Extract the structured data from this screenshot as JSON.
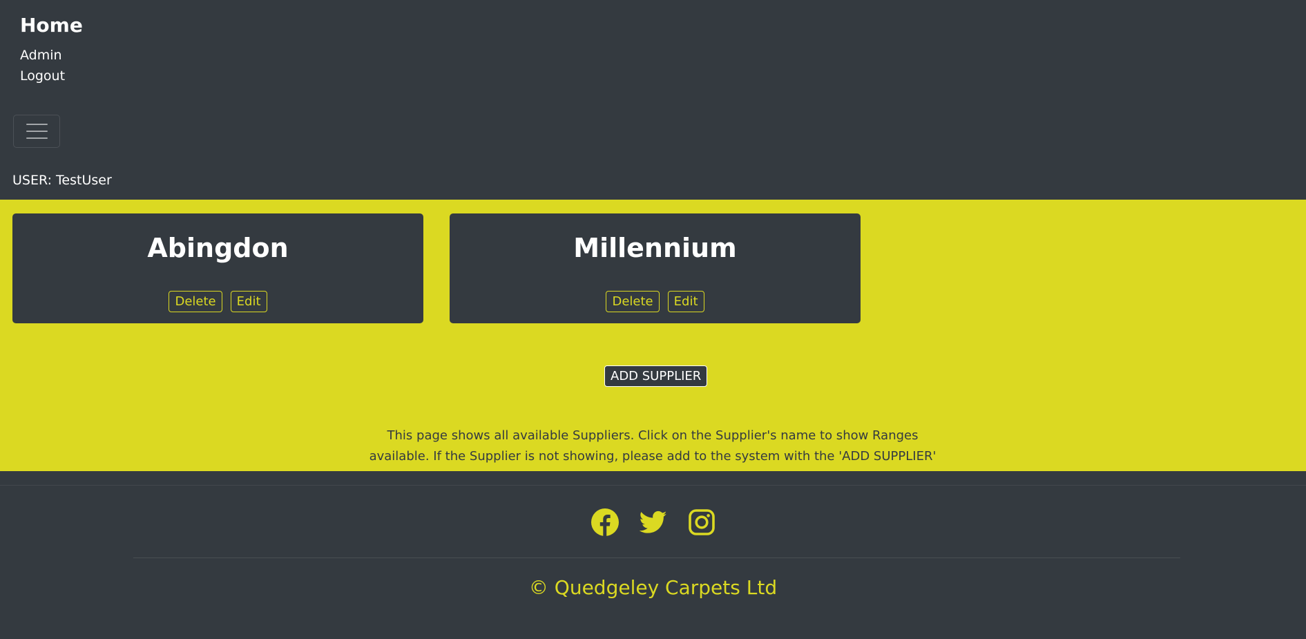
{
  "header": {
    "brand": "Home",
    "nav": [
      {
        "label": "Admin"
      },
      {
        "label": "Logout"
      }
    ],
    "user_text": "USER: TestUser"
  },
  "suppliers": [
    {
      "name": "Abingdon",
      "delete_label": "Delete",
      "edit_label": "Edit"
    },
    {
      "name": "Millennium",
      "delete_label": "Delete",
      "edit_label": "Edit"
    }
  ],
  "add_button": "ADD SUPPLIER",
  "info_text": "This page shows all available Suppliers. Click on the Supplier's name to show Ranges available. If the Supplier is not showing, please add to the system with the 'ADD SUPPLIER' button.",
  "footer": {
    "social_icons": [
      "facebook-icon",
      "twitter-icon",
      "instagram-icon"
    ],
    "copyright": "© Quedgeley Carpets Ltd"
  },
  "colors": {
    "dark": "#343a40",
    "accent": "#dbd922",
    "text": "#ffffff"
  }
}
